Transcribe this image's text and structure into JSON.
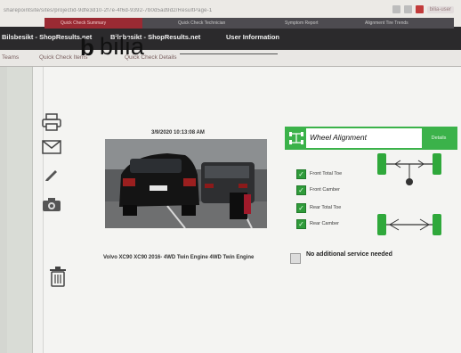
{
  "browser": {
    "url": "sharepointsite/sites/projectid-9dfe3d10-2f7e-4f6d-9392-7b0d5ad9d2/ResultPage-1",
    "profile_label": "bilia-user"
  },
  "app_tabs": [
    {
      "label": "Bilsbesikt - ShopResults.net"
    },
    {
      "label": "Bilsbesikt - ShopResults.net"
    },
    {
      "label": "User Information"
    }
  ],
  "sub_tabs": [
    {
      "label": "Teams"
    },
    {
      "label": "Quick Check Items"
    },
    {
      "label": "Quick Check Details"
    }
  ],
  "header_strip": {
    "items": [
      {
        "label": "Quick Check Summary"
      },
      {
        "label": "Quick Check Technician"
      },
      {
        "label": "Symptom Report"
      },
      {
        "label": "Alignment Tire Trends"
      }
    ]
  },
  "logo": {
    "mark": "b",
    "text": "bilia"
  },
  "inspection": {
    "timestamp": "3/9/2020 10:13:08 AM",
    "vehicle": "Volvo XC90 XC90 2016- 4WD Twin Engine 4WD Twin Engine"
  },
  "wheel_alignment": {
    "title": "Wheel Alignment",
    "button_label": "Details",
    "checks": [
      {
        "label": "Front Total Toe"
      },
      {
        "label": "Front Camber"
      },
      {
        "label": "Rear Total Toe"
      },
      {
        "label": "Rear Camber"
      }
    ]
  },
  "no_additional_service": {
    "label": "No additional service needed"
  },
  "colors": {
    "accent": "#3bb24a",
    "header_active": "#9a2a33",
    "appbar": "#2b2a2c"
  }
}
